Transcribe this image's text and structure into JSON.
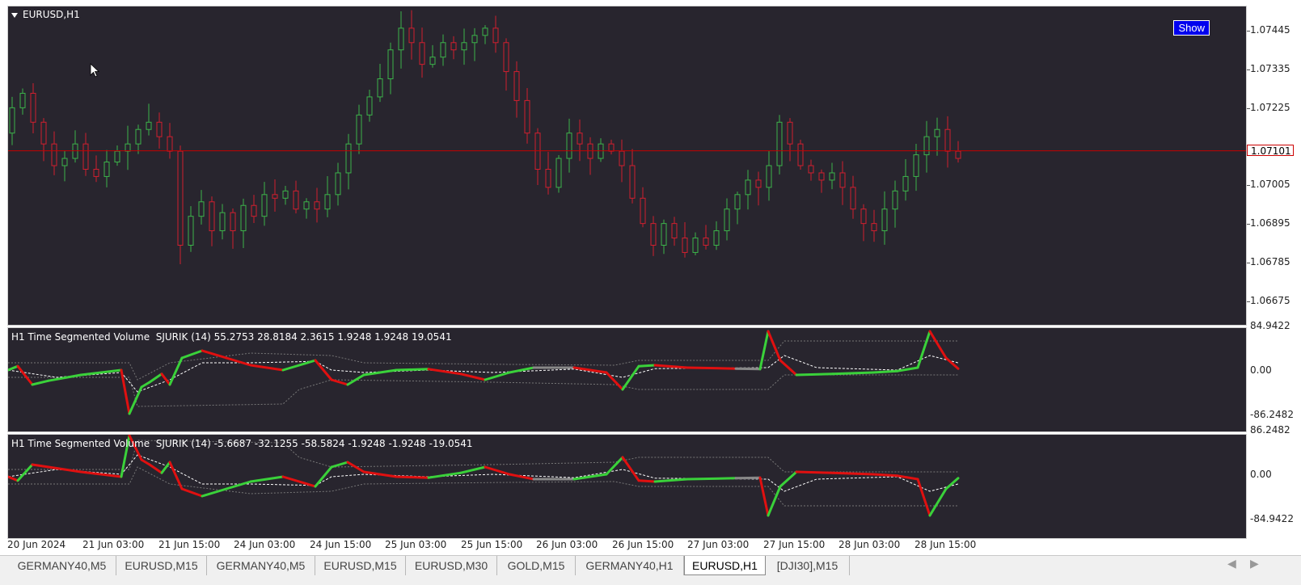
{
  "main": {
    "symbol": "EURUSD,H1",
    "show_button": "Show",
    "last_price": "1.07101",
    "price_ticks": [
      "1.07445",
      "1.07335",
      "1.07225",
      "1.07005",
      "1.06895",
      "1.06785",
      "1.06675"
    ],
    "colors": {
      "bull": "#3cb34a",
      "bear": "#d11f2f",
      "price_line": "#c40000",
      "background": "#28252e"
    }
  },
  "indicator1": {
    "label": "H1 Time Segmented Volume  SJURIK (14) 55.2753 28.8184 2.3615 1.9248 1.9248 19.0541",
    "ticks": [
      "84.9422",
      "0.00",
      "-86.2482"
    ]
  },
  "indicator2": {
    "label": "H1 Time Segmented Volume  SJURIK (14) -5.6687 -32.1255 -58.5824 -1.9248 -1.9248 -19.0541",
    "ticks": [
      "86.2482",
      "0.00",
      "-84.9422"
    ]
  },
  "time_axis": [
    "20 Jun 2024",
    "21 Jun 03:00",
    "21 Jun 15:00",
    "24 Jun 03:00",
    "24 Jun 15:00",
    "25 Jun 03:00",
    "25 Jun 15:00",
    "26 Jun 03:00",
    "26 Jun 15:00",
    "27 Jun 03:00",
    "27 Jun 15:00",
    "28 Jun 03:00",
    "28 Jun 15:00"
  ],
  "tabs": [
    "GERMANY40,M5",
    "EURUSD,M15",
    "GERMANY40,M5",
    "EURUSD,M15",
    "EURUSD,M30",
    "GOLD,M15",
    "GERMANY40,H1",
    "EURUSD,H1",
    "[DJI30],M15"
  ],
  "active_tab": "EURUSD,H1",
  "tab_nav": {
    "prev": "◀",
    "next": "▶"
  },
  "chart_data": {
    "type": "candlestick",
    "ohlc_close": [
      1.0722,
      1.0726,
      1.0718,
      1.0712,
      1.0706,
      1.0708,
      1.0712,
      1.0705,
      1.0703,
      1.0707,
      1.071,
      1.0712,
      1.0716,
      1.0718,
      1.0714,
      1.071,
      1.0684,
      1.0692,
      1.0696,
      1.0688,
      1.0693,
      1.0688,
      1.0695,
      1.0692,
      1.0698,
      1.0697,
      1.0699,
      1.0694,
      1.0696,
      1.0694,
      1.0698,
      1.0704,
      1.0712,
      1.072,
      1.0725,
      1.073,
      1.0738,
      1.0744,
      1.074,
      1.0734,
      1.0736,
      1.074,
      1.0738,
      1.074,
      1.0742,
      1.0744,
      1.074,
      1.0732,
      1.0724,
      1.0715,
      1.0705,
      1.07,
      1.0708,
      1.0715,
      1.0712,
      1.0708,
      1.0712,
      1.071,
      1.0706,
      1.0697,
      1.069,
      1.0684,
      1.069,
      1.0686,
      1.0682,
      1.0686,
      1.0684,
      1.0688,
      1.0694,
      1.0698,
      1.0702,
      1.07,
      1.0706,
      1.0718,
      1.0712,
      1.0706,
      1.0704,
      1.0702,
      1.0704,
      1.07,
      1.0694,
      1.069,
      1.0688,
      1.0694,
      1.0699,
      1.0703,
      1.0709,
      1.0714,
      1.0716,
      1.071,
      1.0708
    ],
    "ylim": [
      1.0662,
      1.075
    ],
    "last_price": 1.07101
  }
}
